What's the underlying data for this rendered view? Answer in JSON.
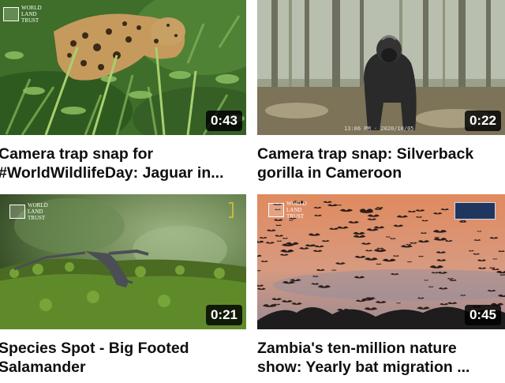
{
  "videos": [
    {
      "title": "Camera trap snap for #WorldWildlifeDay: Jaguar in...",
      "duration": "0:43",
      "logo": "WORLD LAND TRUST"
    },
    {
      "title": "Camera trap snap: Silverback gorilla in Cameroon",
      "duration": "0:22",
      "overlay_text": "13:06 PM · 2020/10/05"
    },
    {
      "title": "Species Spot - Big Footed Salamander",
      "duration": "0:21",
      "logo": "WORLD LAND TRUST"
    },
    {
      "title": "Zambia's ten-million nature show: Yearly bat migration ...",
      "duration": "0:45",
      "logo": "WORLD LAND TRUST"
    }
  ],
  "colors": {
    "title_text": "#0f0f0f",
    "duration_bg": "#000000",
    "sunset_sky": "#d98a66"
  }
}
